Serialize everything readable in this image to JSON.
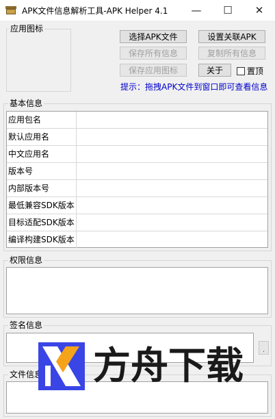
{
  "window": {
    "title": "APK文件信息解析工具-APK Helper 4.1",
    "controls": {
      "minimize": "—",
      "maximize": "☐",
      "close": "✕"
    }
  },
  "icon_group": {
    "label": "应用图标"
  },
  "toolbar": {
    "select_apk": "选择APK文件",
    "set_association": "设置关联APK",
    "save_all": "保存所有信息",
    "copy_all": "复制所有信息",
    "save_icon": "保存应用图标",
    "about": "关于",
    "pin_top": "置顶",
    "hint": "提示：拖拽APK文件到窗口即可查看信息"
  },
  "basic_info": {
    "label": "基本信息",
    "rows": [
      {
        "label": "应用包名",
        "value": ""
      },
      {
        "label": "默认应用名",
        "value": ""
      },
      {
        "label": "中文应用名",
        "value": ""
      },
      {
        "label": "版本号",
        "value": ""
      },
      {
        "label": "内部版本号",
        "value": ""
      },
      {
        "label": "最低兼容SDK版本",
        "value": ""
      },
      {
        "label": "目标适配SDK版本",
        "value": ""
      },
      {
        "label": "编译构建SDK版本",
        "value": ""
      }
    ]
  },
  "permissions": {
    "label": "权限信息",
    "value": ""
  },
  "signature": {
    "label": "签名信息",
    "value": "",
    "side_button": "."
  },
  "file_info": {
    "label": "文件信息",
    "value": ""
  },
  "watermark": {
    "text": "方舟下载"
  },
  "colors": {
    "hint": "#0000cc",
    "logo_blue": "#3a45e6",
    "logo_orange": "#f5a31a"
  }
}
